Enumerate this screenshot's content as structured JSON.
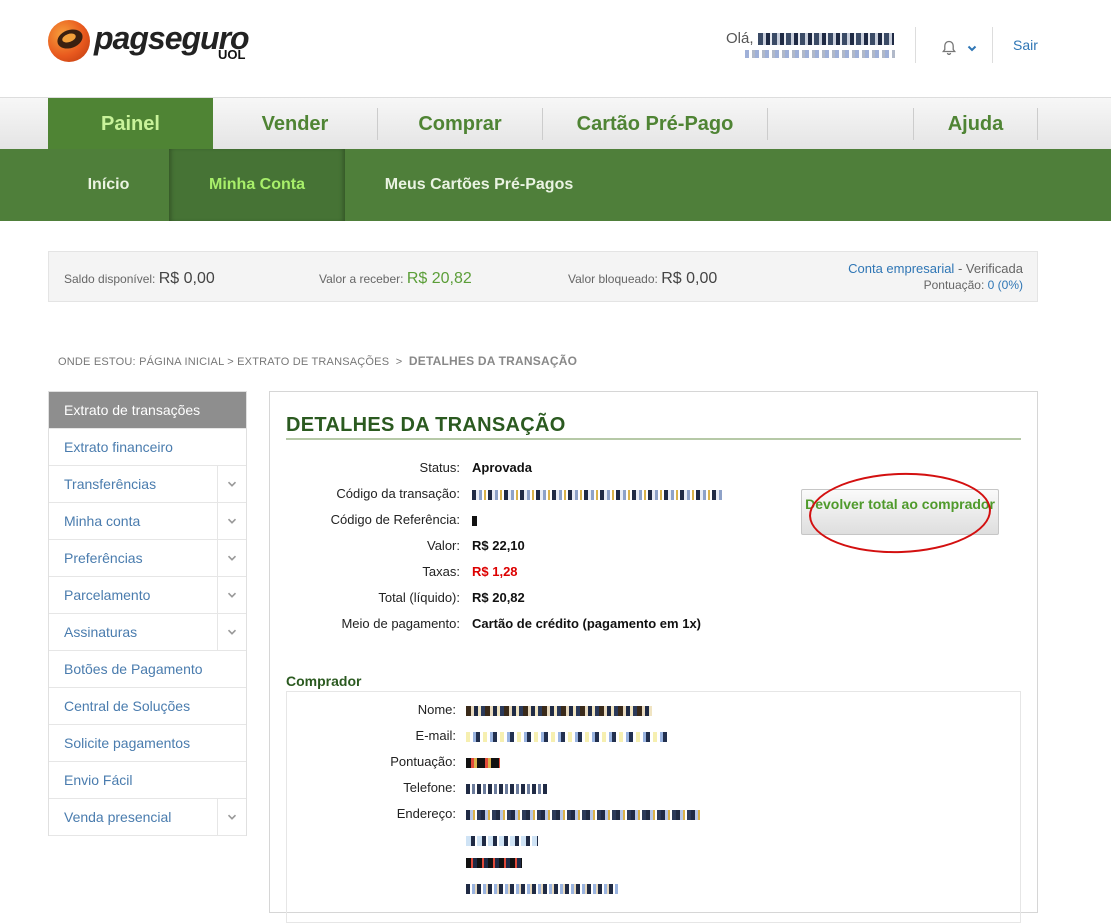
{
  "header": {
    "logo_text": "pagseguro",
    "logo_sub": "UOL",
    "greeting": "Olá,",
    "logout_label": "Sair"
  },
  "main_nav": [
    {
      "label": "Painel",
      "active": true
    },
    {
      "label": "Vender",
      "active": false
    },
    {
      "label": "Comprar",
      "active": false
    },
    {
      "label": "Cartão Pré-Pago",
      "active": false
    },
    {
      "label": "Ajuda",
      "active": false
    }
  ],
  "sub_nav": [
    {
      "label": "Início",
      "active": false
    },
    {
      "label": "Minha Conta",
      "active": true
    },
    {
      "label": "Meus Cartões Pré-Pagos",
      "active": false
    }
  ],
  "balance": {
    "available_label": "Saldo disponível:",
    "available_value": "R$ 0,00",
    "receivable_label": "Valor a receber:",
    "receivable_value": "R$ 20,82",
    "blocked_label": "Valor bloqueado:",
    "blocked_value": "R$ 0,00",
    "account_type": "Conta empresarial",
    "account_status": "- Verificada",
    "points_label": "Pontuação:",
    "points_value": "0 (0%)"
  },
  "breadcrumb": {
    "prefix": "ONDE ESTOU:",
    "items": [
      "PÁGINA INICIAL",
      "EXTRATO DE TRANSAÇÕES"
    ],
    "current": "DETALHES DA TRANSAÇÃO",
    "separator": ">"
  },
  "sidebar": [
    {
      "label": "Extrato de transações",
      "active": true,
      "expandable": false
    },
    {
      "label": "Extrato financeiro",
      "active": false,
      "expandable": false
    },
    {
      "label": "Transferências",
      "active": false,
      "expandable": true
    },
    {
      "label": "Minha conta",
      "active": false,
      "expandable": true
    },
    {
      "label": "Preferências",
      "active": false,
      "expandable": true
    },
    {
      "label": "Parcelamento",
      "active": false,
      "expandable": true
    },
    {
      "label": "Assinaturas",
      "active": false,
      "expandable": true
    },
    {
      "label": "Botões de Pagamento",
      "active": false,
      "expandable": false
    },
    {
      "label": "Central de Soluções",
      "active": false,
      "expandable": false
    },
    {
      "label": "Solicite pagamentos",
      "active": false,
      "expandable": false
    },
    {
      "label": "Envio Fácil",
      "active": false,
      "expandable": false
    },
    {
      "label": "Venda presencial",
      "active": false,
      "expandable": true
    }
  ],
  "details": {
    "title": "DETALHES DA TRANSAÇÃO",
    "rows": [
      {
        "label": "Status:",
        "value": "Aprovada"
      },
      {
        "label": "Código da transação:",
        "value": ""
      },
      {
        "label": "Código de Referência:",
        "value": ""
      },
      {
        "label": "Valor:",
        "value": "R$ 22,10"
      },
      {
        "label": "Taxas:",
        "value": "R$ 1,28",
        "highlight": "red"
      },
      {
        "label": "Total (líquido):",
        "value": "R$ 20,82"
      },
      {
        "label": "Meio de pagamento:",
        "value": "Cartão de crédito (pagamento em 1x)"
      }
    ],
    "refund_button": "Devolver total ao comprador"
  },
  "buyer": {
    "title": "Comprador",
    "labels": [
      "Nome:",
      "E-mail:",
      "Pontuação:",
      "Telefone:",
      "Endereço:"
    ]
  },
  "colors": {
    "brand_green": "#4f8434",
    "subnav_green": "#4f7f3a",
    "link_blue": "#2f76b5",
    "alert_red": "#d00000"
  }
}
